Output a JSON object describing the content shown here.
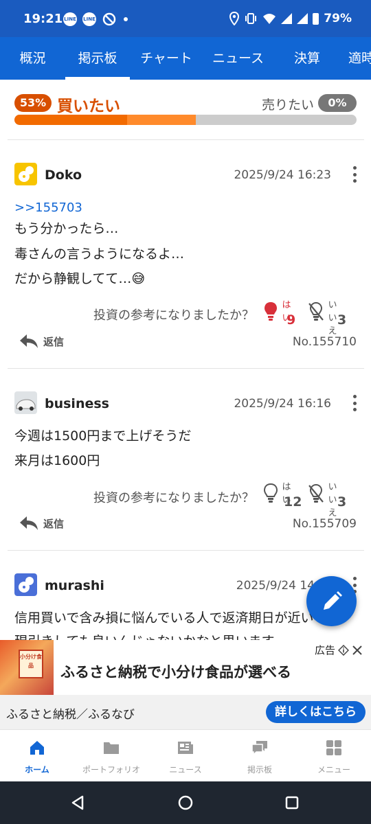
{
  "status_bar": {
    "time": "19:21",
    "battery": "79%",
    "notif_icons": [
      "LINE",
      "LINE"
    ]
  },
  "tabs": [
    "概況",
    "掲示板",
    "チャート",
    "ニュース",
    "決算",
    "適時"
  ],
  "active_tab": 1,
  "sentiment": {
    "buy_percent": "53%",
    "buy_label": "買いたい",
    "sell_label": "売りたい",
    "sell_percent": "0%",
    "bar_fill_fraction": 0.53
  },
  "posts": [
    {
      "username": "Doko",
      "date": "2025/9/24 16:23",
      "reply_to": ">>155703",
      "lines": [
        "もう分かったら…",
        "毒さんの言うようになるよ…",
        "だから静観してて…😅"
      ],
      "question": "投資の参考になりましたか？",
      "yes_label": "はい",
      "yes_count": "9",
      "no_label": "いいえ",
      "no_count": "3",
      "reply_label": "返信",
      "post_no": "No.155710"
    },
    {
      "username": "business",
      "date": "2025/9/24 16:16",
      "reply_to": "",
      "lines": [
        "今週は1500円まで上げそうだ",
        "来月は1600円"
      ],
      "question": "投資の参考になりましたか？",
      "yes_label": "はい",
      "yes_count": "12",
      "no_label": "いいえ",
      "no_count": "3",
      "reply_label": "返信",
      "post_no": "No.155709"
    },
    {
      "username": "murashi",
      "date": "2025/9/24 14",
      "lines": [
        "信用買いで含み損に悩んでいる人で返済期日が近い",
        "現引きしても良いんじゃないかなと思います"
      ]
    }
  ],
  "ad": {
    "label": "広告",
    "title": "ふるさと納税で小分け食品が選べる",
    "source": "ふるさと納税／ふるなび",
    "cta": "詳しくはこちら",
    "image_text": "小分け食品"
  },
  "bottom_nav": [
    "ホーム",
    "ポートフォリオ",
    "ニュース",
    "掲示板",
    "メニュー"
  ],
  "colors": {
    "primary": "#1166d4",
    "status_bar": "#1a5bbf",
    "buy": "#d84f00",
    "yes_active": "#d8303a"
  }
}
